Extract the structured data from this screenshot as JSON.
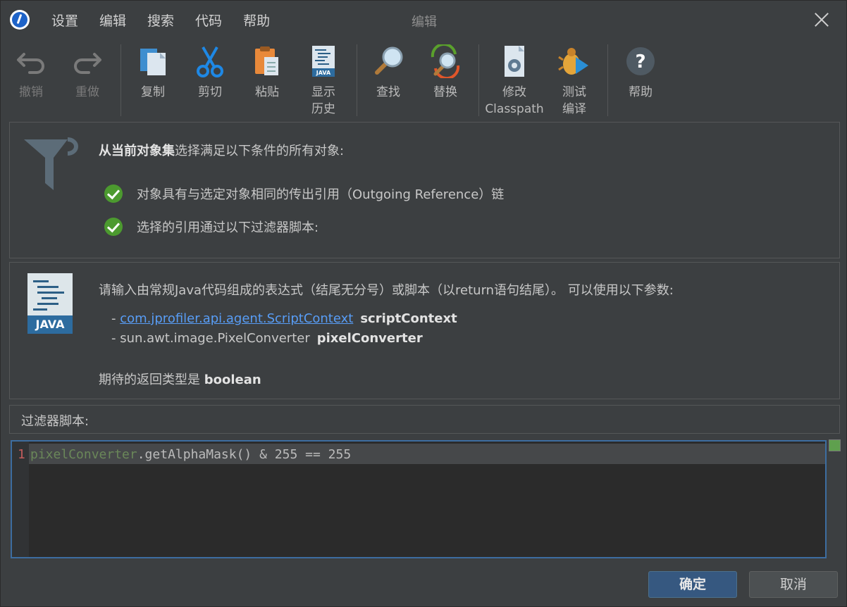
{
  "menubar": {
    "items": [
      "设置",
      "编辑",
      "搜索",
      "代码",
      "帮助"
    ]
  },
  "window": {
    "title": "编辑"
  },
  "toolbar": {
    "undo": "撤销",
    "redo": "重做",
    "copy": "复制",
    "cut": "剪切",
    "paste": "粘贴",
    "history_l1": "显示",
    "history_l2": "历史",
    "find": "查找",
    "replace": "替换",
    "classpath_l1": "修改",
    "classpath_l2": "Classpath",
    "compile_l1": "测试",
    "compile_l2": "编译",
    "help": "帮助"
  },
  "filter_panel": {
    "heading_bold": "从当前对象集",
    "heading_rest": "选择满足以下条件的所有对象:",
    "conditions": [
      "对象具有与选定对象相同的传出引用（Outgoing Reference）链",
      "选择的引用通过以下过滤器脚本:"
    ]
  },
  "info_panel": {
    "java_label": "JAVA",
    "intro": "请输入由常规Java代码组成的表达式（结尾无分号）或脚本（以return语句结尾）。 可以使用以下参数:",
    "params": [
      {
        "dash": "- ",
        "type": "com.jprofiler.api.agent.ScriptContext",
        "name": "scriptContext"
      },
      {
        "dash": "- ",
        "type": "sun.awt.image.PixelConverter",
        "name": "pixelConverter"
      }
    ],
    "return_prefix": "期待的返回类型是 ",
    "return_type": "boolean"
  },
  "script_label": "过滤器脚本:",
  "editor": {
    "line_number": "1",
    "code_var": "pixelConverter",
    "code_rest": ".getAlphaMask() & 255 == 255"
  },
  "buttons": {
    "ok": "确定",
    "cancel": "取消"
  }
}
